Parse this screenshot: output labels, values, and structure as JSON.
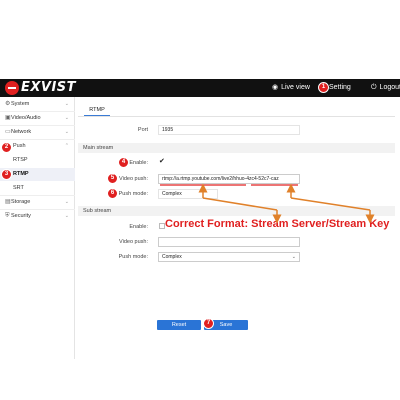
{
  "header": {
    "logo_text": "EXVIST",
    "live_view_label": "Live view",
    "setting_label": "Setting",
    "logout_label": "Logout",
    "live_view_icon": "eye-icon",
    "setting_icon": "gear-icon",
    "logout_icon": "logout-icon"
  },
  "sidebar": {
    "items": [
      {
        "label": "System",
        "icon": "system-icon"
      },
      {
        "label": "Video/Audio",
        "icon": "video-icon"
      },
      {
        "label": "Network",
        "icon": "network-icon"
      },
      {
        "label": "Push",
        "icon": "push-icon"
      },
      {
        "label": "RTSP"
      },
      {
        "label": "RTMP"
      },
      {
        "label": "SRT"
      },
      {
        "label": "Storage",
        "icon": "storage-icon"
      },
      {
        "label": "Security",
        "icon": "shield-icon"
      }
    ]
  },
  "tabs": [
    {
      "label": "RTMP",
      "active": true
    }
  ],
  "form": {
    "port_label": "Port",
    "port_value": "1935",
    "main_stream_title": "Main stream",
    "enable_label": "Enable:",
    "enable_checked": true,
    "video_push_label": "Video push:",
    "video_push_value": "rtmp://a.rtmp.youtube.com/live2/hhuo-4zc4-52c7-caz",
    "push_mode_label": "Push mode:",
    "push_mode_value": "Complex",
    "sub_stream_title": "Sub stream",
    "sub_enable_label": "Enable:",
    "sub_enable_checked": false,
    "sub_video_push_label": "Video push:",
    "sub_video_push_value": "",
    "sub_push_mode_label": "Push mode:",
    "sub_push_mode_value": "Complex"
  },
  "buttons": {
    "reset": "Reset",
    "save": "Save"
  },
  "annotation": {
    "text": "Correct Format: Stream Server/Stream Key",
    "color": "#e02020"
  },
  "badges": [
    "1",
    "2",
    "3",
    "4",
    "5",
    "6",
    "7"
  ],
  "colors": {
    "accent": "#2a74d6",
    "annotation_red": "#e02020",
    "header_bg": "#111111",
    "arrow_orange": "#e0812a"
  }
}
